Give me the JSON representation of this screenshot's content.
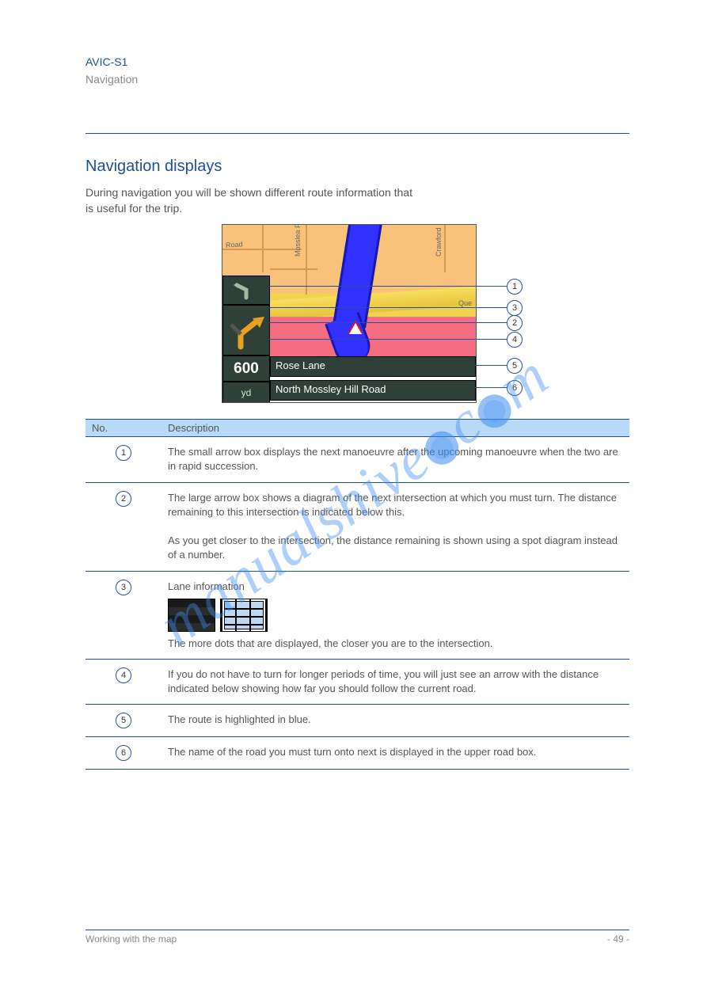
{
  "header": {
    "product": "AVIC-S1",
    "page_label": "Navigation"
  },
  "section": {
    "title": "Navigation displays",
    "intro": "During navigation you will be shown different route information that is useful for the trip."
  },
  "nav_figure": {
    "panel3_value": "600",
    "panel4_unit": "yd",
    "rowbar1": "Rose Lane",
    "rowbar2": "North Mossley Hill Road",
    "maplabels": {
      "road_label": "Road",
      "park_label": "Mosslea Park",
      "right_label": "Crawford",
      "que_label": "Que"
    }
  },
  "callouts": [
    "1",
    "2",
    "3",
    "4",
    "5",
    "6"
  ],
  "table": {
    "head_no": "No.",
    "head_desc": "Description",
    "rows": [
      {
        "no": "1",
        "text": "The small arrow box displays the next manoeuvre after the upcoming manoeuvre when the two are in rapid succession."
      },
      {
        "no": "2",
        "text": "The large arrow box shows a diagram of the next intersection at which you must turn. The distance remaining to this intersection is indicated below this.\n\nAs you get closer to the intersection, the distance remaining is shown using a spot diagram instead of a number."
      },
      {
        "no": "3",
        "lead": "Lane information",
        "text_after": "The more dots that are displayed, the closer you are to the intersection."
      },
      {
        "no": "4",
        "text": "If you do not have to turn for longer periods of time, you will just see an arrow with the distance indicated below showing how far you should follow the current road."
      },
      {
        "no": "5",
        "text": "The route is highlighted in blue."
      },
      {
        "no": "6",
        "text": "The name of the road you must turn onto next is displayed in the upper road box."
      }
    ]
  },
  "footer": {
    "left": "Working with the map",
    "right": "- 49 -"
  },
  "watermark": {
    "a": "manualshive",
    "b": "c",
    "c": "m"
  }
}
